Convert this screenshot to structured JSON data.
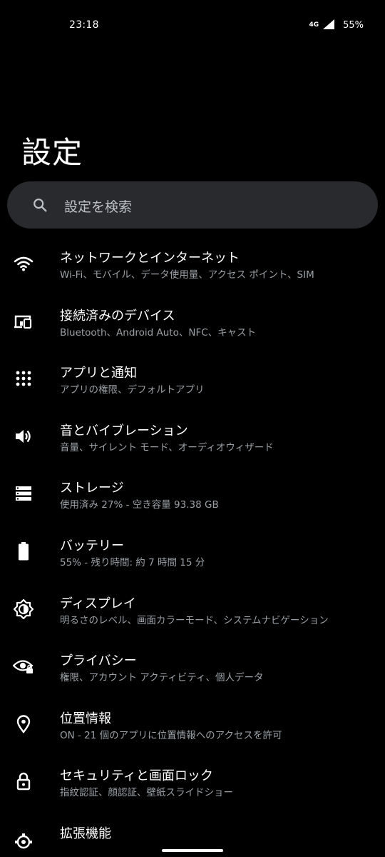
{
  "status": {
    "time": "23:18",
    "network": "4G",
    "battery": "55%"
  },
  "header": {
    "title": "設定"
  },
  "search": {
    "placeholder": "設定を検索"
  },
  "settings": {
    "items": [
      {
        "title": "ネットワークとインターネット",
        "subtitle": "Wi-Fi、モバイル、データ使用量、アクセス ポイント、SIM",
        "icon": "wifi-icon"
      },
      {
        "title": "接続済みのデバイス",
        "subtitle": "Bluetooth、Android Auto、NFC、キャスト",
        "icon": "devices-icon"
      },
      {
        "title": "アプリと通知",
        "subtitle": "アプリの権限、デフォルトアプリ",
        "icon": "apps-grid-icon"
      },
      {
        "title": "音とバイブレーション",
        "subtitle": "音量、サイレント モード、オーディオウィザード",
        "icon": "volume-icon"
      },
      {
        "title": "ストレージ",
        "subtitle": "使用済み 27% - 空き容量 93.38 GB",
        "icon": "storage-icon"
      },
      {
        "title": "バッテリー",
        "subtitle": "55% - 残り時間: 約 7 時間 15 分",
        "icon": "battery-icon"
      },
      {
        "title": "ディスプレイ",
        "subtitle": "明るさのレベル、画面カラーモード、システムナビゲーション",
        "icon": "brightness-icon"
      },
      {
        "title": "プライバシー",
        "subtitle": "権限、アカウント アクティビティ、個人データ",
        "icon": "privacy-eye-icon"
      },
      {
        "title": "位置情報",
        "subtitle": "ON - 21 個のアプリに位置情報へのアクセスを許可",
        "icon": "location-pin-icon"
      },
      {
        "title": "セキュリティと画面ロック",
        "subtitle": "指紋認証、顔認証、壁紙スライドショー",
        "icon": "lock-icon"
      },
      {
        "title": "拡張機能",
        "subtitle": "",
        "icon": "extensions-gear-icon"
      }
    ]
  },
  "colors": {
    "background": "#000000",
    "search_bg": "#292a2d",
    "title_text": "#ffffff",
    "subtitle_text": "#9aa0a6"
  }
}
